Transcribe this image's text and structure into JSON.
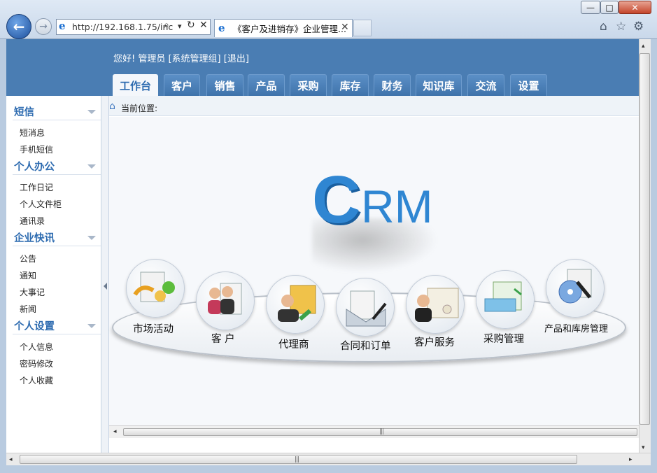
{
  "window": {
    "min_label": "—",
    "max_label": "□",
    "close_label": "✕"
  },
  "browser": {
    "back_icon": "←",
    "forward_icon": "→",
    "url": "http://192.168.1.75/inc",
    "search_icon": "⌕",
    "dropdown_icon": "▾",
    "refresh_icon": "↻",
    "stop_icon": "✕",
    "tab_title": "《客户及进销存》企业管理...",
    "tab_close": "✕",
    "home_icon": "⌂",
    "favorites_icon": "☆",
    "tools_icon": "⚙"
  },
  "header": {
    "greeting": "您好! 管理员 [系统管理组] [退出]",
    "tabs": [
      "工作台",
      "客户",
      "销售",
      "产品",
      "采购",
      "库存",
      "财务",
      "知识库",
      "交流",
      "设置"
    ],
    "active_tab": "工作台"
  },
  "sidebar": {
    "sections": [
      {
        "title": "短信",
        "items": [
          "短消息",
          "手机短信"
        ]
      },
      {
        "title": "个人办公",
        "items": [
          "工作日记",
          "个人文件柜",
          "通讯录"
        ]
      },
      {
        "title": "企业快讯",
        "items": [
          "公告",
          "通知",
          "大事记",
          "新闻"
        ]
      },
      {
        "title": "个人设置",
        "items": [
          "个人信息",
          "密码修改",
          "个人收藏"
        ]
      }
    ]
  },
  "breadcrumb": {
    "label": "当前位置:"
  },
  "logo": {
    "c": "C",
    "rm": "RM"
  },
  "modules": [
    "市场活动",
    "客 户",
    "代理商",
    "合同和订单",
    "客户服务",
    "采购管理",
    "产品和库房管理"
  ],
  "scroll": {
    "grip": "|||",
    "left": "◂",
    "right": "▸",
    "up": "▴",
    "down": "▾"
  }
}
